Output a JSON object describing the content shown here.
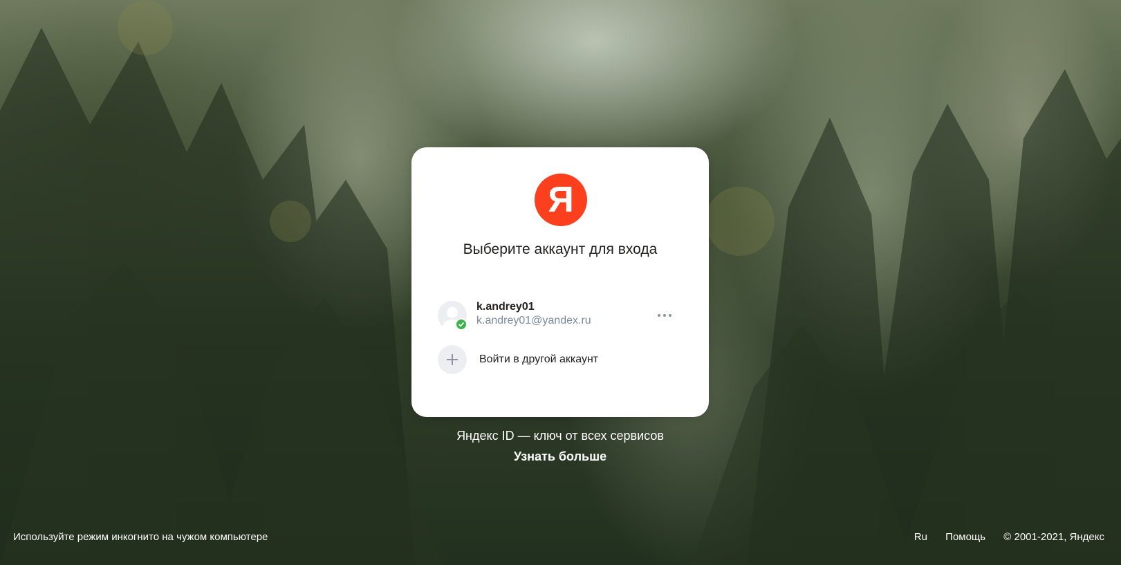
{
  "logo": {
    "letter": "Я",
    "color": "#fc3f1d"
  },
  "card": {
    "title": "Выберите аккаунт для входа",
    "account": {
      "login": "k.andrey01",
      "email": "k.andrey01@yandex.ru",
      "verified_icon": "check-badge-icon",
      "more_icon": "more-dots-icon"
    },
    "add_account": {
      "label": "Войти в другой аккаунт",
      "icon": "plus-icon"
    }
  },
  "promo": {
    "text": "Яндекс ID — ключ от всех сервисов",
    "link": "Узнать больше"
  },
  "footer": {
    "left": "Используйте режим инкогнито на чужом компьютере",
    "language": "Ru",
    "help": "Помощь",
    "copyright": "© 2001-2021, Яндекс"
  },
  "colors": {
    "accent": "#fc3f1d",
    "secondary_text": "#7b8a9f",
    "verified": "#3bb34a"
  }
}
